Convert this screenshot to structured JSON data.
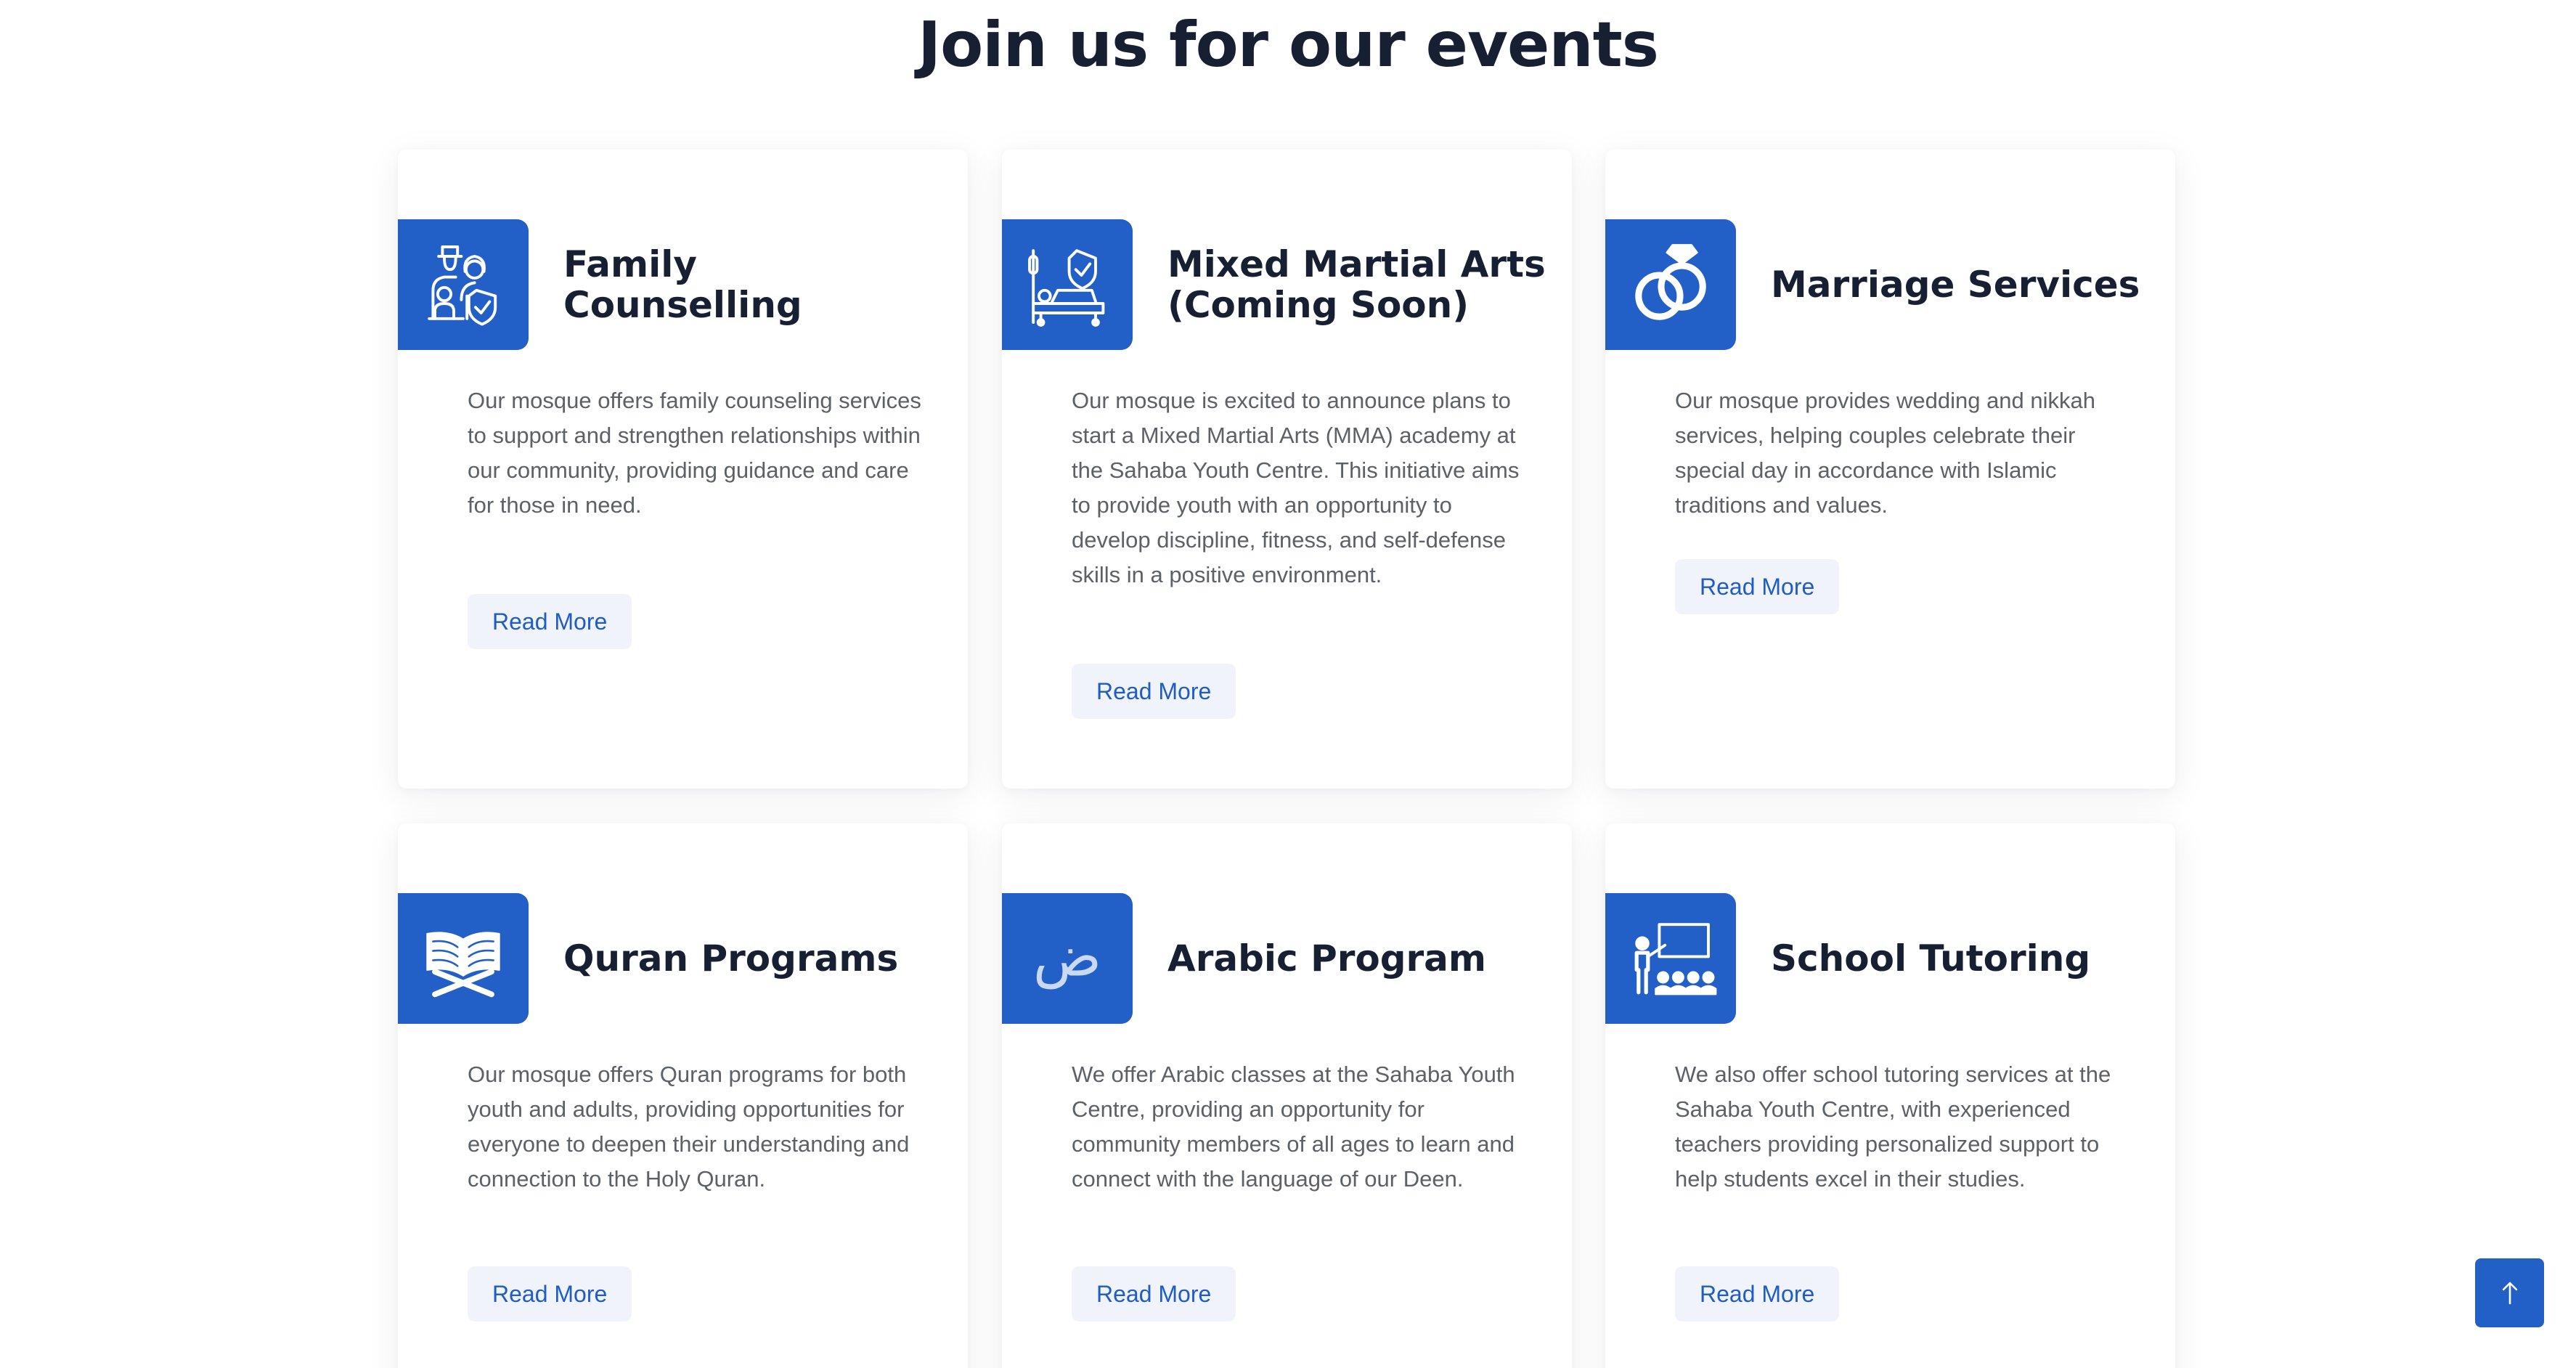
{
  "section": {
    "title": "Join us for our events"
  },
  "theme": {
    "accent": "#2260c7",
    "heading": "#172033",
    "body_text": "#5c6168",
    "button_bg": "#f0f3fa",
    "button_text": "#1f5cc4"
  },
  "cards": [
    {
      "icon": "family-counselling-icon",
      "title_lines": [
        "Family",
        "Counselling"
      ],
      "description": "Our mosque offers family counseling services to support and strengthen relationships within our community, providing guidance and care for those in need.",
      "button_label": "Read More"
    },
    {
      "icon": "martial-arts-icon",
      "title_lines": [
        "Mixed Martial Arts",
        "(Coming Soon)"
      ],
      "description": "Our mosque is excited to announce plans to start a Mixed Martial Arts (MMA) academy at the Sahaba Youth Centre. This initiative aims to provide youth with an opportunity to develop discipline, fitness, and self-defense skills in a positive environment.",
      "button_label": "Read More"
    },
    {
      "icon": "wedding-rings-icon",
      "title_lines": [
        "Marriage Services"
      ],
      "description": "Our mosque provides wedding and nikkah services, helping couples celebrate their special day in accordance with Islamic traditions and values.",
      "button_label": "Read More"
    },
    {
      "icon": "quran-book-icon",
      "title_lines": [
        "Quran Programs"
      ],
      "description": "Our mosque offers Quran programs for both youth and adults, providing opportunities for everyone to deepen their understanding and connection to the Holy Quran.",
      "button_label": "Read More"
    },
    {
      "icon": "arabic-letter-icon",
      "icon_glyph": "ض",
      "title_lines": [
        "Arabic Program"
      ],
      "description": "We offer Arabic classes at the Sahaba Youth Centre, providing an opportunity for community members of all ages to learn and connect with the language of our Deen.",
      "button_label": "Read More"
    },
    {
      "icon": "classroom-teacher-icon",
      "title_lines": [
        "School Tutoring"
      ],
      "description": "We also offer school tutoring services at the Sahaba Youth Centre, with experienced teachers providing personalized support to help students excel in their studies.",
      "button_label": "Read More"
    }
  ],
  "scroll_to_top": {
    "icon": "arrow-up-icon"
  }
}
